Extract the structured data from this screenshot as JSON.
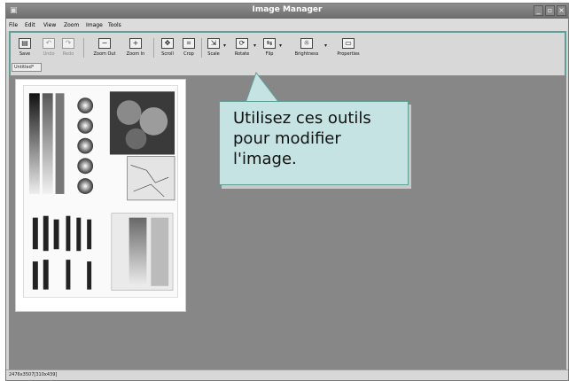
{
  "window": {
    "title": "Image Manager",
    "controls": [
      "_",
      "▫",
      "×"
    ]
  },
  "menu": [
    "File",
    "Edit",
    "View",
    "Zoom",
    "Image",
    "Tools"
  ],
  "toolbar": {
    "save": "Save",
    "undo": "Undo",
    "redo": "Redo",
    "zoom_out": "Zoom Out",
    "zoom_in": "Zoom In",
    "scroll": "Scroll",
    "crop": "Crop",
    "scale": "Scale",
    "rotate": "Rotate",
    "flip": "Flip",
    "brightness": "Brightness",
    "properties": "Properties"
  },
  "tab": {
    "label": "Untitled*"
  },
  "status": {
    "text": "2476x3507[310x439]"
  },
  "callout": {
    "line1": "Utilisez ces outils",
    "line2": "pour modifier",
    "line3": "l'image."
  },
  "colors": {
    "accent": "#5e9f96",
    "callout_bg": "#c6e3e3",
    "canvas_bg": "#878787"
  }
}
